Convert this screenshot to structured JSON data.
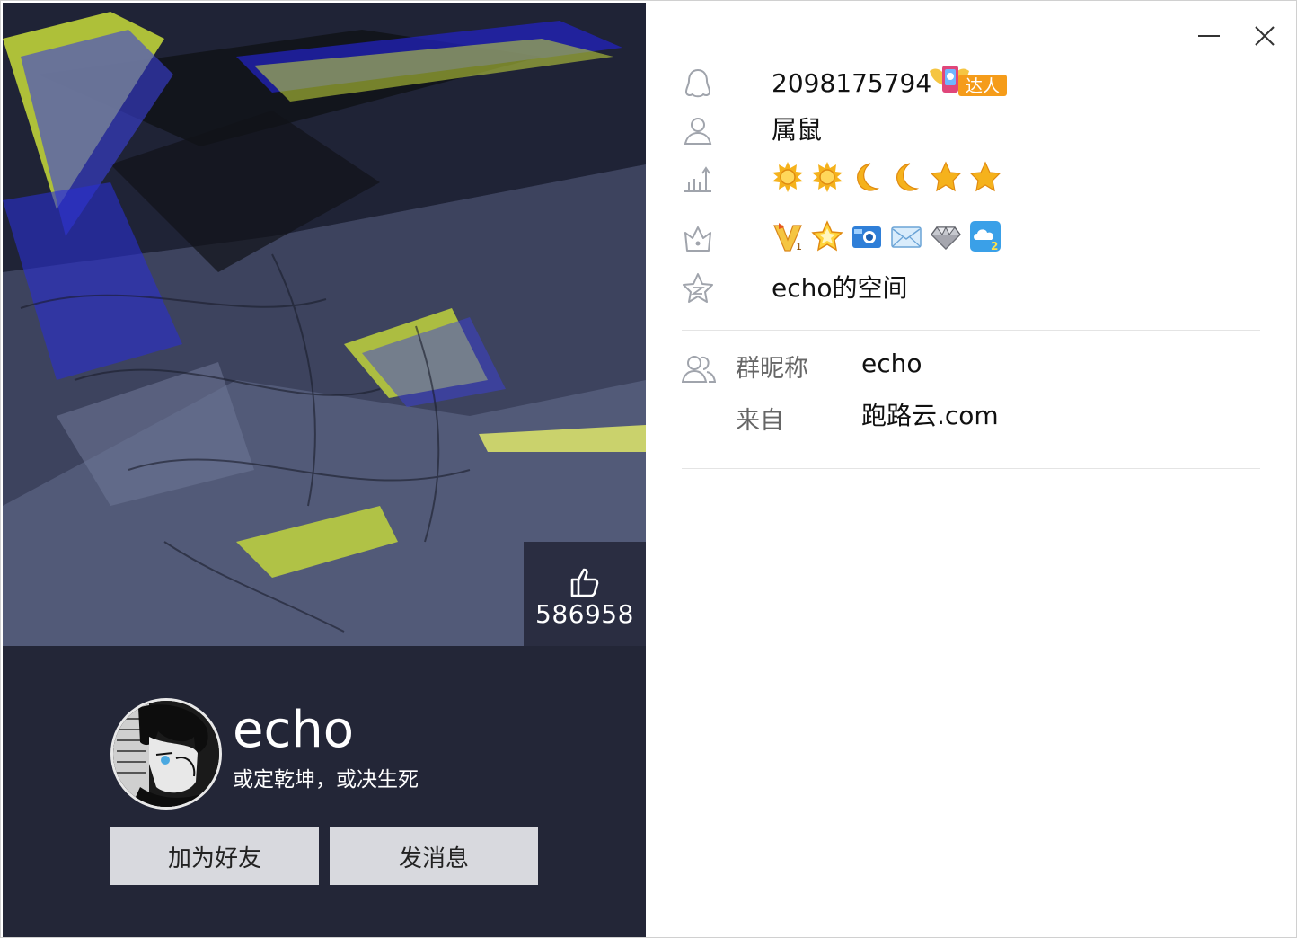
{
  "profile": {
    "nickname": "echo",
    "signature": "或定乾坤，或决生死",
    "likes": "586958",
    "add_friend_label": "加为好友",
    "send_message_label": "发消息"
  },
  "details": {
    "qq_number": "2098175794",
    "daren_badge": "达人",
    "zodiac": "属鼠",
    "level_icons": [
      "sun-icon",
      "sun-icon",
      "moon-icon",
      "moon-icon",
      "star-icon",
      "star-icon"
    ],
    "privilege_icons": [
      "vip-icon",
      "star-badge-icon",
      "camera-icon",
      "mail-icon",
      "diamond-icon",
      "cloud-icon"
    ],
    "qzone": "echo的空间",
    "group_nick_label": "群昵称",
    "group_nick_value": "echo",
    "from_label": "来自",
    "from_value": "跑路云.com"
  },
  "colors": {
    "panel_bg": "#232637",
    "button_bg": "#d8d9de",
    "icon_gray": "#a0a4ac",
    "badge_gold": "#f5b21c",
    "badge_blue": "#2f7fd8"
  }
}
